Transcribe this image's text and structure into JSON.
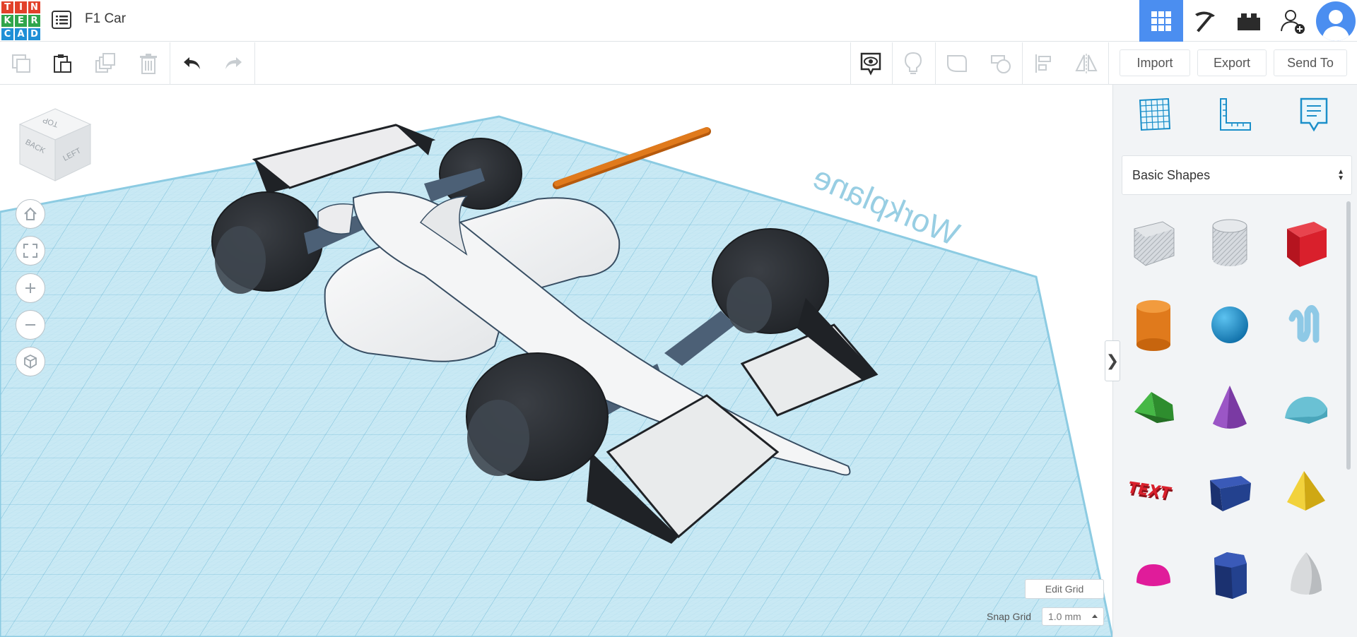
{
  "header": {
    "logo_letters": [
      "T",
      "I",
      "N",
      "K",
      "E",
      "R",
      "C",
      "A",
      "D"
    ],
    "logo_colors": [
      "#e2412a",
      "#e2412a",
      "#e2412a",
      "#2fa54b",
      "#2fa54b",
      "#2fa54b",
      "#1f8fd6",
      "#1f8fd6",
      "#1f8fd6"
    ],
    "project_title": "F1 Car",
    "right_buttons": [
      "3d-design-view",
      "build-pickaxe-view",
      "bricks-view",
      "add-user",
      "avatar"
    ]
  },
  "toolbar": {
    "left_icons": [
      "copy",
      "paste",
      "duplicate",
      "delete",
      "undo",
      "redo"
    ],
    "right_icons": [
      "show-all-eye",
      "light-bulb",
      "group",
      "ungroup",
      "align",
      "mirror"
    ],
    "import_label": "Import",
    "export_label": "Export",
    "send_to_label": "Send To"
  },
  "workplane": {
    "viewcube": {
      "top": "TOP",
      "back": "BACK",
      "left": "LEFT"
    },
    "watermark": "Workplane",
    "edit_grid_label": "Edit Grid",
    "snap_grid_label": "Snap Grid",
    "snap_grid_value": "1.0 mm",
    "colors": {
      "grid_fill": "#b9e0ef",
      "grid_line": "#8cc9e0",
      "car_body": "#f2f3f4",
      "tire": "#2b2e33",
      "rod": "#e07a1c"
    }
  },
  "panel": {
    "tool_icons": [
      "grid-icon",
      "ruler-icon",
      "notes-icon"
    ],
    "category_label": "Basic Shapes",
    "shapes": [
      {
        "name": "box-hole",
        "color": "#c9ced4"
      },
      {
        "name": "cylinder-hole",
        "color": "#c9ced4"
      },
      {
        "name": "box",
        "color": "#d9202c"
      },
      {
        "name": "cylinder",
        "color": "#e8801c"
      },
      {
        "name": "sphere",
        "color": "#1c8fd0"
      },
      {
        "name": "scribble",
        "color": "#8ec9e6"
      },
      {
        "name": "roof",
        "color": "#3aa33a"
      },
      {
        "name": "cone",
        "color": "#7a3aa3"
      },
      {
        "name": "round-roof",
        "color": "#6ac1d4"
      },
      {
        "name": "text",
        "color": "#d9202c"
      },
      {
        "name": "wedge",
        "color": "#23418e"
      },
      {
        "name": "pyramid",
        "color": "#e8c21c"
      },
      {
        "name": "half-sphere",
        "color": "#e01c9a"
      },
      {
        "name": "polygon",
        "color": "#23418e"
      },
      {
        "name": "paraboloid",
        "color": "#d8dadc"
      }
    ],
    "text_shape_label": "TEXT"
  }
}
